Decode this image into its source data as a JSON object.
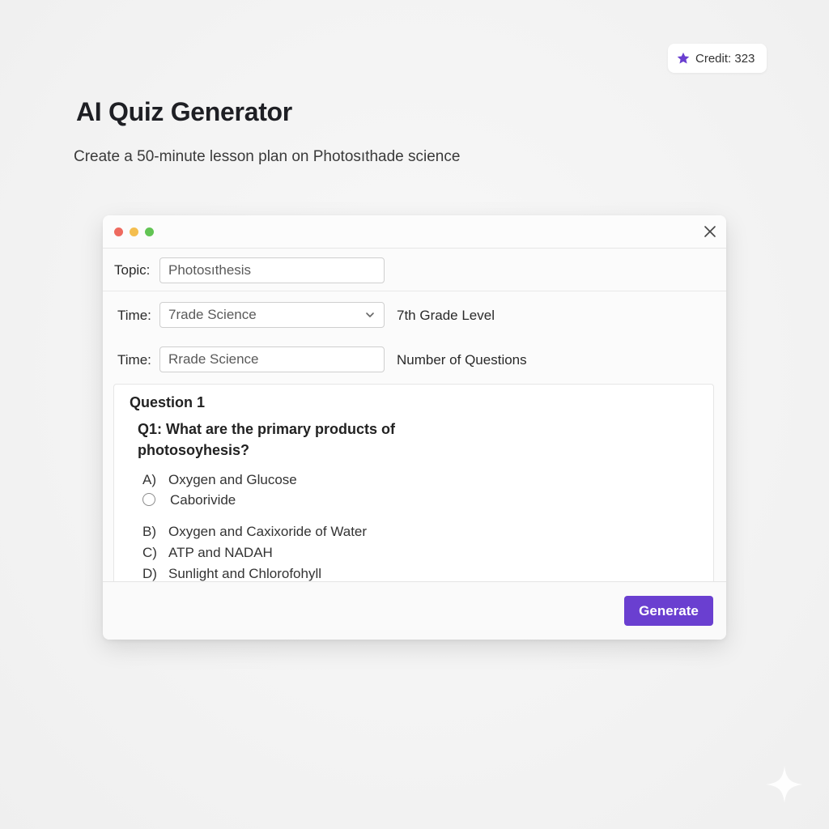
{
  "credit": {
    "label": "Credit: 323",
    "icon": "star-icon",
    "icon_color": "#6a3fd0"
  },
  "header": {
    "title": "AI Quiz Generator",
    "subtitle": "Create a 50-minute lesson plan on Photosıthade science"
  },
  "window": {
    "topic": {
      "label": "Topic:",
      "value": "Photosıthesis"
    },
    "grade_row": {
      "label": "Time:",
      "selected": "7rade Science",
      "side_label": "7th Grade Level"
    },
    "questions_row": {
      "label": "Time:",
      "value": "Rrade Science",
      "side_label": "Number of Questions"
    },
    "question": {
      "heading": "Question 1",
      "text": "Q1: What are the primary products of photosoyhesis?",
      "options": [
        {
          "letter": "A)",
          "text": "Oxygen and Glucose"
        },
        {
          "letter": "",
          "text": "Caborivide"
        },
        {
          "letter": "B)",
          "text": "Oxygen and Caxixoride of Water"
        },
        {
          "letter": "C)",
          "text": "ATP and NADAH"
        },
        {
          "letter": "D)",
          "text": "Sunlight and Chlorofohyll"
        }
      ]
    },
    "generate_label": "Generate"
  },
  "colors": {
    "accent": "#6a3fd0",
    "dot_red": "#ee6a5f",
    "dot_yellow": "#f4be4f",
    "dot_green": "#62c454"
  }
}
